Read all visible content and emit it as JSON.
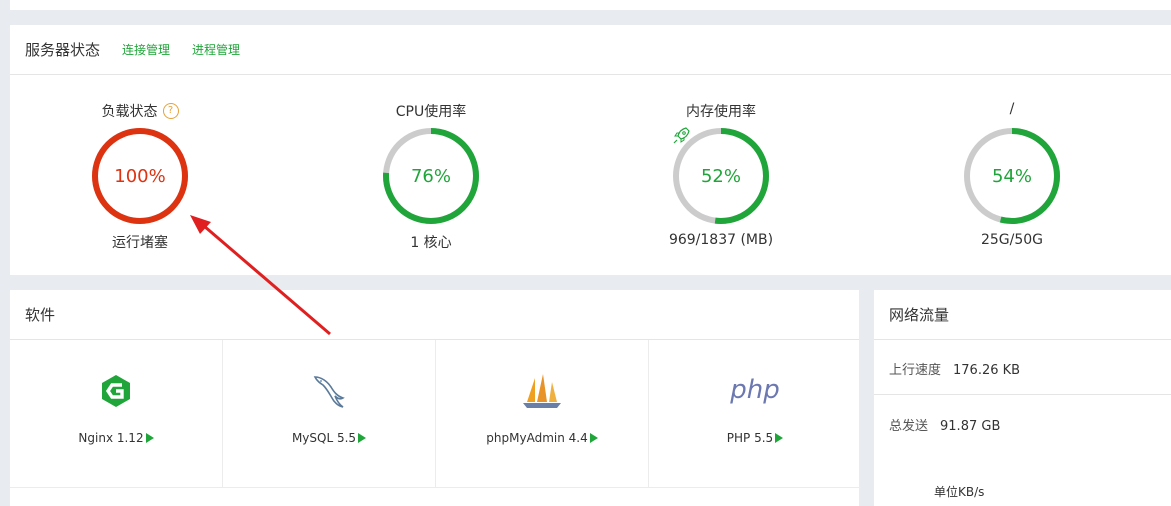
{
  "status": {
    "title": "服务器状态",
    "links": [
      "连接管理",
      "进程管理"
    ],
    "gauges": [
      {
        "label": "负载状态",
        "value_text": "100%",
        "percent": 100,
        "sub": "运行堵塞",
        "help": "?",
        "color": "#dd3311"
      },
      {
        "label": "CPU使用率",
        "value_text": "76%",
        "percent": 76,
        "sub": "1 核心",
        "color": "#20a53a"
      },
      {
        "label": "内存使用率",
        "value_text": "52%",
        "percent": 52,
        "sub": "969/1837 (MB)",
        "color": "#20a53a",
        "icon": "rocket-icon"
      },
      {
        "label": "/",
        "value_text": "54%",
        "percent": 54,
        "sub": "25G/50G",
        "color": "#20a53a"
      }
    ]
  },
  "software": {
    "title": "软件",
    "items": [
      {
        "name": "Nginx 1.12",
        "icon": "nginx-icon"
      },
      {
        "name": "MySQL 5.5",
        "icon": "mysql-dolphin-icon"
      },
      {
        "name": "phpMyAdmin 4.4",
        "icon": "phpmyadmin-sailboat-icon"
      },
      {
        "name": "PHP 5.5",
        "icon": "php-logo-icon"
      }
    ]
  },
  "network": {
    "title": "网络流量",
    "upload_label": "上行速度",
    "upload_value": "176.26 KB",
    "sent_label": "总发送",
    "sent_value": "91.87 GB",
    "unit": "单位KB/s"
  },
  "theme": {
    "accent": "#20a53a",
    "danger": "#dd3311",
    "track": "#cccccc",
    "arrow": "#e02020"
  }
}
